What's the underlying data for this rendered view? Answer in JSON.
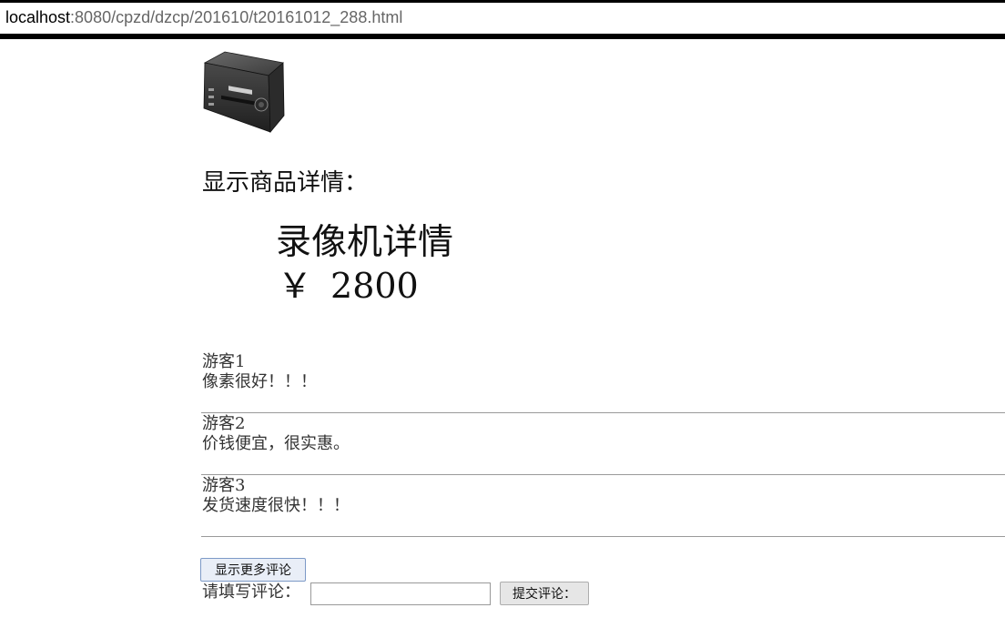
{
  "browser": {
    "url_host": "localhost",
    "url_path": ":8080/cpzd/dzcp/201610/t20161012_288.html"
  },
  "product": {
    "image_icon": "video-recorder-device-icon",
    "section_title": "显示商品详情：",
    "name": "录像机详情",
    "currency": "￥",
    "price": "2800"
  },
  "comments": [
    {
      "author": "游客1",
      "text": "像素很好！！！"
    },
    {
      "author": "游客2",
      "text": "价钱便宜，很实惠。"
    },
    {
      "author": "游客3",
      "text": "发货速度很快！！！"
    }
  ],
  "actions": {
    "more_comments_label": "显示更多评论",
    "comment_label": "请填写评论：",
    "comment_value": "",
    "comment_placeholder": "",
    "submit_label": "提交评论："
  },
  "colors": {
    "text": "#222222",
    "divider": "#9a9a9a",
    "device_body": "#3a3a3a"
  }
}
